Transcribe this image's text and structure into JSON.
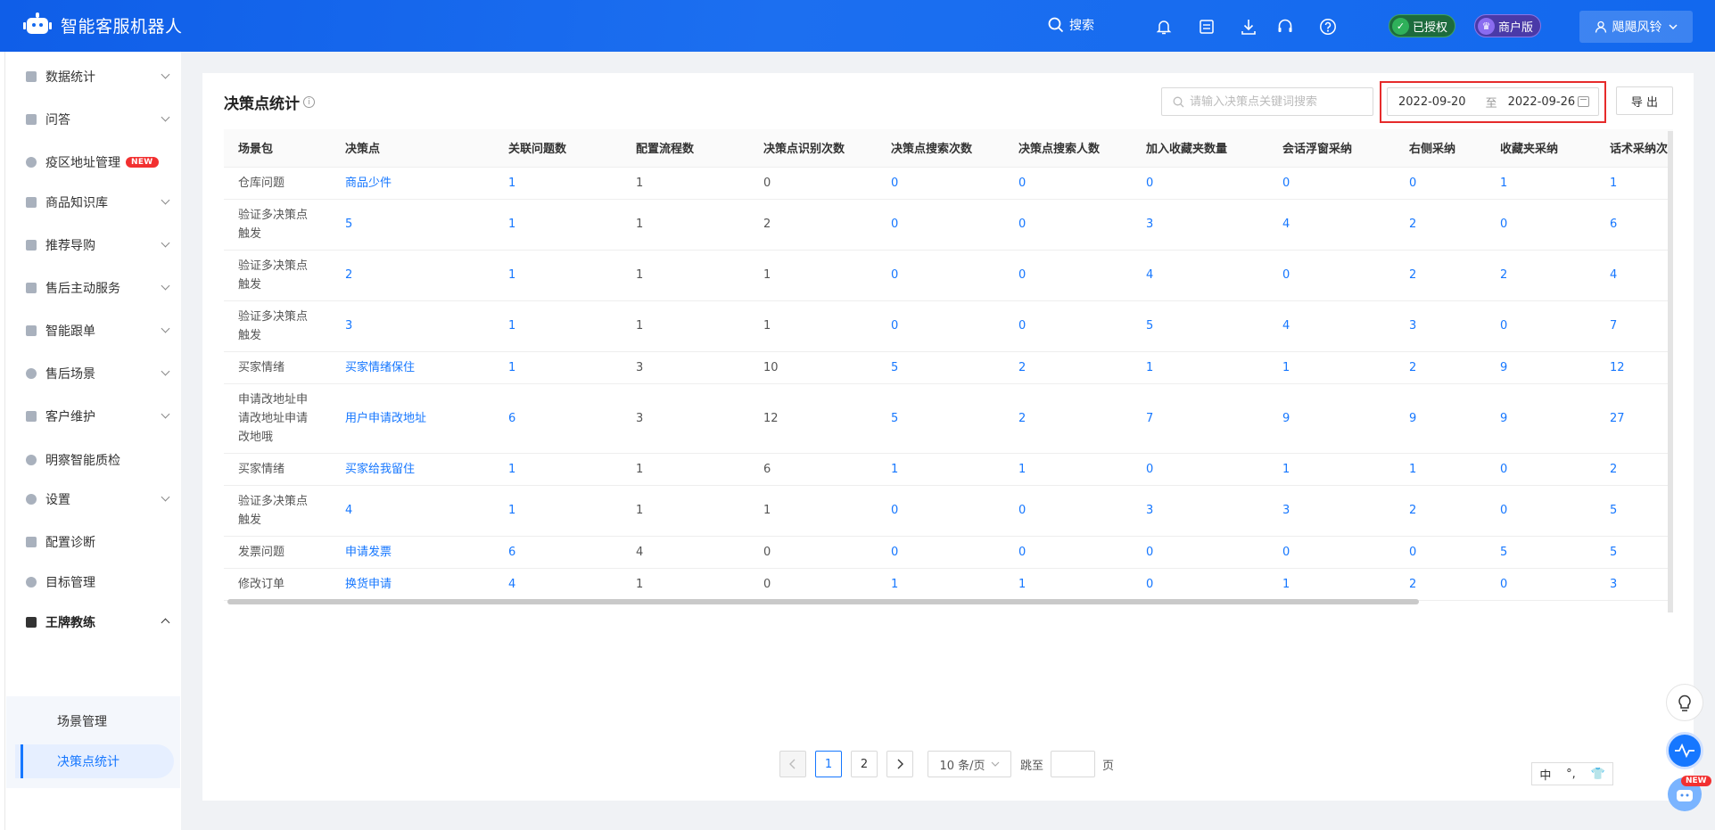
{
  "app": {
    "title": "智能客服机器人"
  },
  "topbar": {
    "search_label": "搜索",
    "auth_badge": "已授权",
    "merchant_badge": "商户版",
    "user_name": "飓飓风铃"
  },
  "sidebar": {
    "items": [
      {
        "label": "数据统计"
      },
      {
        "label": "问答"
      },
      {
        "label": "疫区地址管理",
        "badge": "NEW"
      },
      {
        "label": "商品知识库"
      },
      {
        "label": "推荐导购"
      },
      {
        "label": "售后主动服务"
      },
      {
        "label": "智能跟单"
      },
      {
        "label": "售后场景"
      },
      {
        "label": "客户维护"
      },
      {
        "label": "明察智能质检"
      },
      {
        "label": "设置"
      },
      {
        "label": "配置诊断"
      },
      {
        "label": "目标管理"
      },
      {
        "label": "王牌教练"
      }
    ],
    "submenu": [
      {
        "label": "场景管理"
      },
      {
        "label": "决策点统计"
      }
    ]
  },
  "page": {
    "title": "决策点统计",
    "info_icon": "i",
    "search_placeholder": "请输入决策点关键词搜索",
    "date_start": "2022-09-20",
    "date_sep": "至",
    "date_end": "2022-09-26",
    "export_label": "导 出"
  },
  "table": {
    "headers": [
      "场景包",
      "决策点",
      "关联问题数",
      "配置流程数",
      "决策点识别次数",
      "决策点搜索次数",
      "决策点搜索人数",
      "加入收藏夹数量",
      "会话浮窗采纳",
      "右侧采纳",
      "收藏夹采纳",
      "话术采纳次数"
    ],
    "rows": [
      [
        "仓库问题",
        "商品少件",
        "1",
        "1",
        "0",
        "0",
        "0",
        "0",
        "0",
        "0",
        "1",
        "1"
      ],
      [
        "验证多决策点触发",
        "5",
        "1",
        "1",
        "2",
        "0",
        "0",
        "3",
        "4",
        "2",
        "0",
        "6"
      ],
      [
        "验证多决策点触发",
        "2",
        "1",
        "1",
        "1",
        "0",
        "0",
        "4",
        "0",
        "2",
        "2",
        "4"
      ],
      [
        "验证多决策点触发",
        "3",
        "1",
        "1",
        "1",
        "0",
        "0",
        "5",
        "4",
        "3",
        "0",
        "7"
      ],
      [
        "买家情绪",
        "买家情绪保住",
        "1",
        "3",
        "10",
        "5",
        "2",
        "1",
        "1",
        "2",
        "9",
        "12"
      ],
      [
        "申请改地址申请改地址申请改地哦",
        "用户申请改地址",
        "6",
        "3",
        "12",
        "5",
        "2",
        "7",
        "9",
        "9",
        "9",
        "27"
      ],
      [
        "买家情绪",
        "买家给我留住",
        "1",
        "1",
        "6",
        "1",
        "1",
        "0",
        "1",
        "1",
        "0",
        "2"
      ],
      [
        "验证多决策点触发",
        "4",
        "1",
        "1",
        "1",
        "0",
        "0",
        "3",
        "3",
        "2",
        "0",
        "5"
      ],
      [
        "发票问题",
        "申请发票",
        "6",
        "4",
        "0",
        "0",
        "0",
        "0",
        "0",
        "0",
        "5",
        "5"
      ],
      [
        "修改订单",
        "换货申请",
        "4",
        "1",
        "0",
        "1",
        "1",
        "0",
        "1",
        "2",
        "0",
        "3"
      ]
    ]
  },
  "pagination": {
    "pages": [
      "1",
      "2"
    ],
    "current": "1",
    "page_size": "10 条/页",
    "jump_label": "跳至",
    "page_suffix": "页"
  },
  "lang_bar": {
    "lang": "中",
    "punct": "°,"
  },
  "float_badge": "NEW",
  "colors": {
    "primary": "#1677ff",
    "topbar": "#1268ee",
    "highlight_border": "#e62b2b"
  }
}
